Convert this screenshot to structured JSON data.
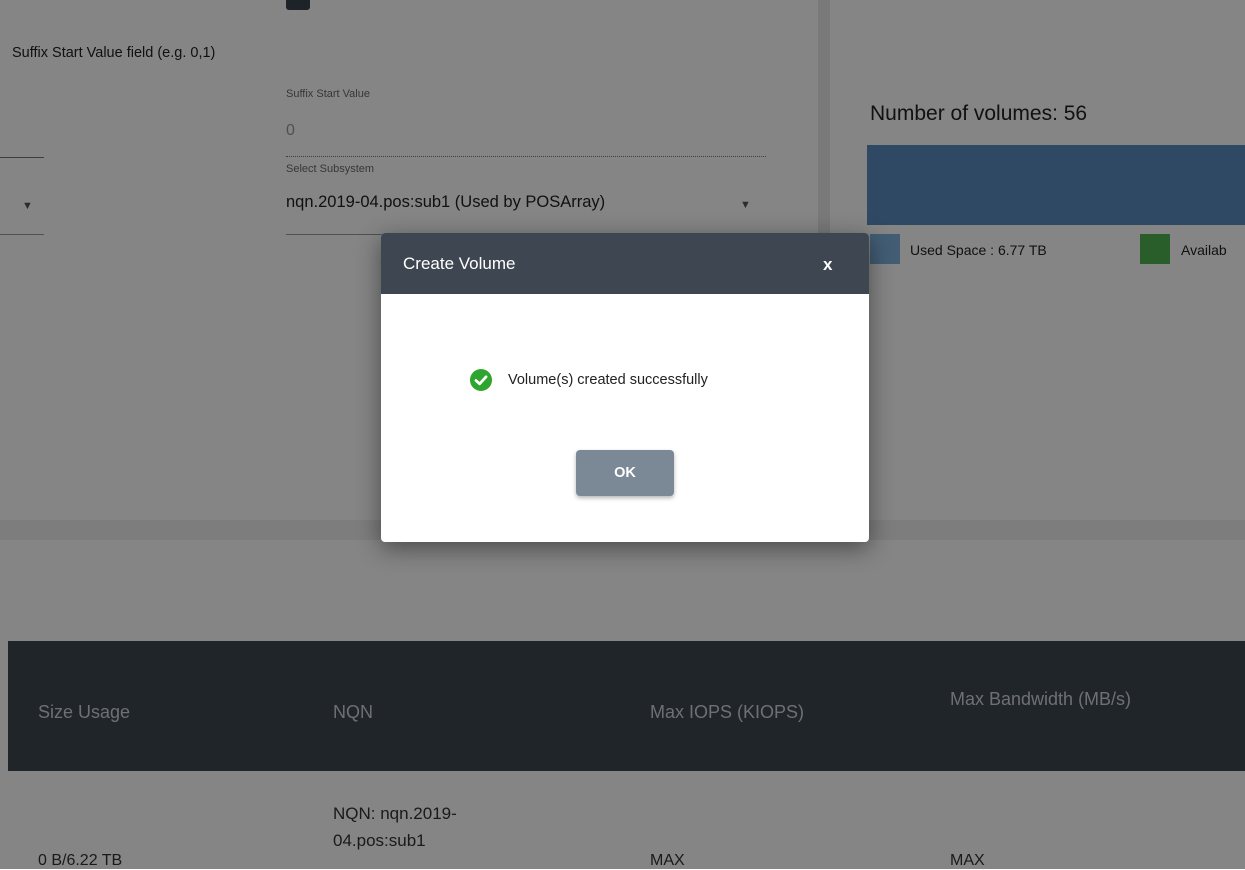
{
  "form": {
    "suffix_hint": "Suffix Start Value field (e.g. 0,1)",
    "suffix_label": "Suffix Start Value",
    "suffix_value": "0",
    "subsystem_label": "Select Subsystem",
    "subsystem_value": "nqn.2019-04.pos:sub1 (Used by POSArray)"
  },
  "capacity": {
    "volumes_count_text": "Number of volumes: 56",
    "used_label": "Used Space : 6.77 TB",
    "available_label": "Availab",
    "used_color": "#7fb2df",
    "bar_color": "#5a8dc0",
    "available_color": "#4fb34f"
  },
  "table": {
    "headers": {
      "size_usage": "Size Usage",
      "nqn": "NQN",
      "max_iops": "Max IOPS (KIOPS)",
      "max_bandwidth": "Max Bandwidth (MB/s)"
    },
    "rows": [
      {
        "size_usage": "0 B/6.22 TB",
        "nqn": "NQN: nqn.2019-04.pos:sub1",
        "max_iops": "MAX",
        "max_bandwidth": "MAX"
      }
    ]
  },
  "modal": {
    "title": "Create Volume",
    "close_label": "x",
    "message": "Volume(s) created successfully",
    "ok_label": "OK",
    "icon": "check-circle-icon",
    "success_color": "#2ea52e",
    "header_color": "#3e4751"
  }
}
